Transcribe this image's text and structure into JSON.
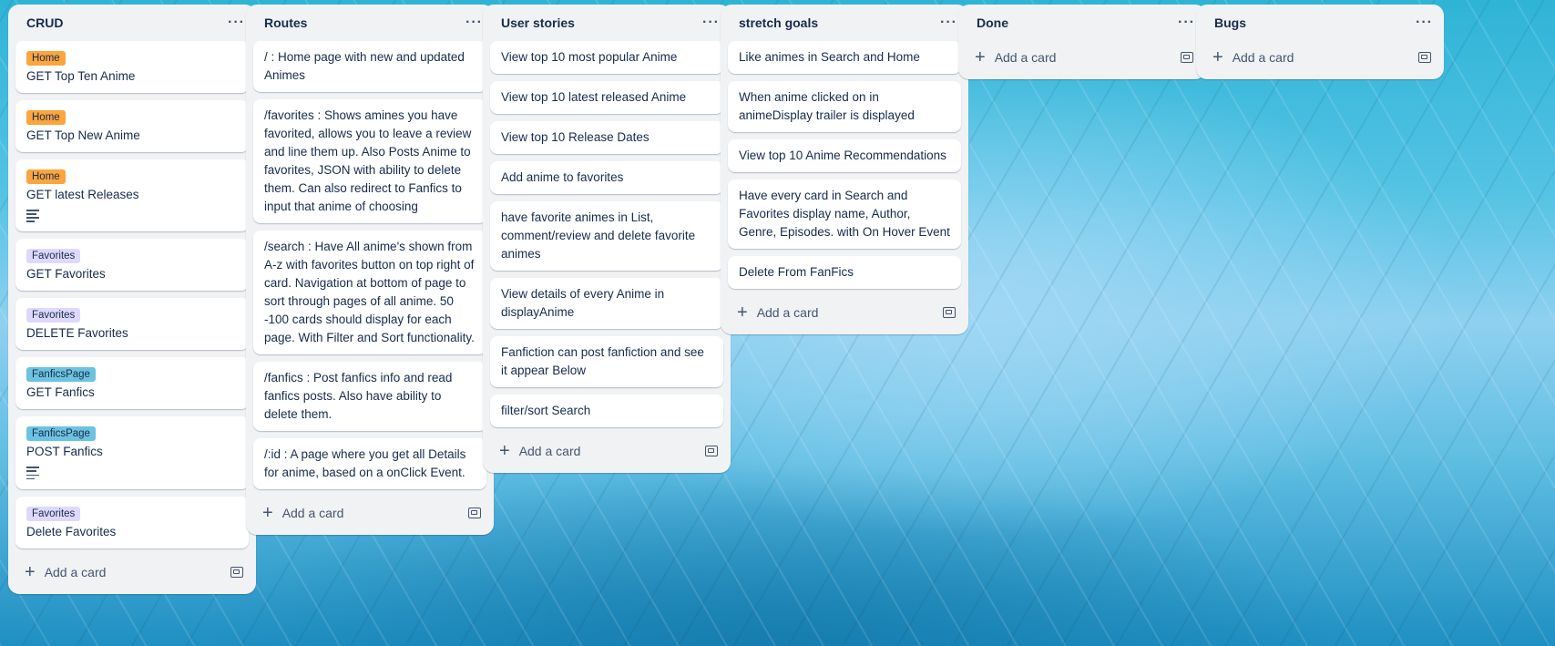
{
  "colors": {
    "home": "#faa53d",
    "favorites": "#dfd8fd",
    "fanficspage": "#6cc3e0"
  },
  "add_card_label": "Add a card",
  "lists": [
    {
      "title": "CRUD",
      "cards": [
        {
          "label": "Home",
          "text": "GET Top Ten Anime"
        },
        {
          "label": "Home",
          "text": "GET Top New Anime"
        },
        {
          "label": "Home",
          "text": "GET latest Releases",
          "has_description": true
        },
        {
          "label": "Favorites",
          "text": "GET Favorites"
        },
        {
          "label": "Favorites",
          "text": "DELETE Favorites"
        },
        {
          "label": "FanficsPage",
          "text": "GET Fanfics"
        },
        {
          "label": "FanficsPage",
          "text": "POST Fanfics",
          "has_description": true
        },
        {
          "label": "Favorites",
          "text": "Delete Favorites"
        }
      ]
    },
    {
      "title": "Routes",
      "cards": [
        {
          "text": "/ : Home page with new and updated Animes"
        },
        {
          "text": "/favorites : Shows amines you have favorited, allows you to leave a review and line them up. Also Posts Anime to favorites, JSON with ability to delete them. Can also redirect to Fanfics to input that anime of choosing"
        },
        {
          "text": "/search : Have All anime's shown from A-z with favorites button on top right of card. Navigation at bottom of page to sort through pages of all anime. 50 -100 cards should display for each page. With Filter and Sort functionality."
        },
        {
          "text": "/fanfics : Post fanfics info and read fanfics posts. Also have ability to delete them."
        },
        {
          "text": "/:id : A page where you get all Details for anime, based on a onClick Event."
        }
      ]
    },
    {
      "title": "User stories",
      "cards": [
        {
          "text": "View top 10 most popular Anime"
        },
        {
          "text": "View top 10 latest released Anime"
        },
        {
          "text": "View top 10 Release Dates"
        },
        {
          "text": "Add anime to favorites"
        },
        {
          "text": "have favorite animes in List, comment/review and delete favorite animes"
        },
        {
          "text": "View details of every Anime in displayAnime"
        },
        {
          "text": "Fanfiction can post fanfiction and see it appear Below"
        },
        {
          "text": "filter/sort Search"
        }
      ]
    },
    {
      "title": "stretch goals",
      "cards": [
        {
          "text": "Like animes in Search and Home"
        },
        {
          "text": "When anime clicked on in animeDisplay trailer is displayed"
        },
        {
          "text": "View top 10 Anime Recommendations"
        },
        {
          "text": "Have every card in Search and Favorites display name, Author, Genre, Episodes. with On Hover Event"
        },
        {
          "text": "Delete From FanFics"
        }
      ]
    },
    {
      "title": "Done",
      "cards": []
    },
    {
      "title": "Bugs",
      "cards": []
    }
  ]
}
